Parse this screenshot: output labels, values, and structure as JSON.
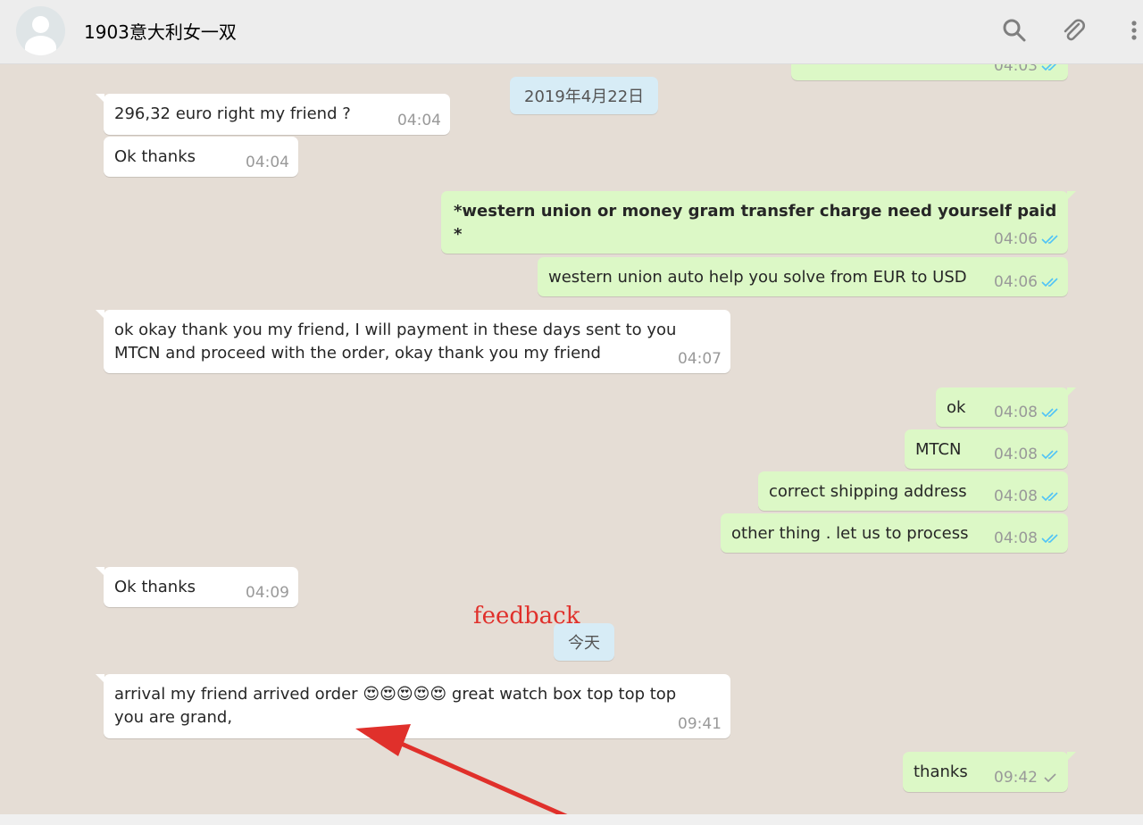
{
  "header": {
    "contact_name": "1903意大利女一双",
    "icons": [
      "avatar-icon",
      "search-icon",
      "attach-icon",
      "menu-icon"
    ]
  },
  "chat": {
    "date_chips": [
      {
        "label": "2019年4月22日"
      },
      {
        "label": "今天"
      }
    ],
    "messages": [
      {
        "dir": "out",
        "text": "",
        "time": "04:03",
        "status": "read"
      },
      {
        "dir": "in",
        "text": "296,32 euro right my friend ?",
        "time": "04:04"
      },
      {
        "dir": "in",
        "text": "Ok thanks",
        "time": "04:04"
      },
      {
        "dir": "out",
        "text": "*western union or money gram transfer charge need yourself paid *",
        "time": "04:06",
        "status": "read"
      },
      {
        "dir": "out",
        "text": "western union auto help you solve from EUR to USD",
        "time": "04:06",
        "status": "read"
      },
      {
        "dir": "in",
        "text": "ok okay thank you my friend, I will payment in these days sent to you MTCN and proceed with the order, okay thank you my friend",
        "time": "04:07"
      },
      {
        "dir": "out",
        "text": "ok",
        "time": "04:08",
        "status": "read"
      },
      {
        "dir": "out",
        "text": "MTCN",
        "time": "04:08",
        "status": "read"
      },
      {
        "dir": "out",
        "text": "correct shipping address",
        "time": "04:08",
        "status": "read"
      },
      {
        "dir": "out",
        "text": "other thing . let us to process",
        "time": "04:08",
        "status": "read"
      },
      {
        "dir": "in",
        "text": "Ok thanks",
        "time": "04:09"
      },
      {
        "dir": "in",
        "text_before": "arrival my friend arrived order",
        "emoji": [
          "😍",
          "😍",
          "😍",
          "😍",
          "😍"
        ],
        "text_after": "great watch box top top top you are grand,",
        "time": "09:41"
      },
      {
        "dir": "out",
        "text": "thanks",
        "time": "09:42",
        "status": "sent"
      }
    ]
  },
  "annotation": {
    "label": "feedback",
    "color": "#e0302b"
  },
  "colors": {
    "incoming": "#ffffff",
    "outgoing": "#dcf8c6",
    "read_ticks": "#4fc3f7",
    "chat_bg": "#e5ddd5"
  }
}
